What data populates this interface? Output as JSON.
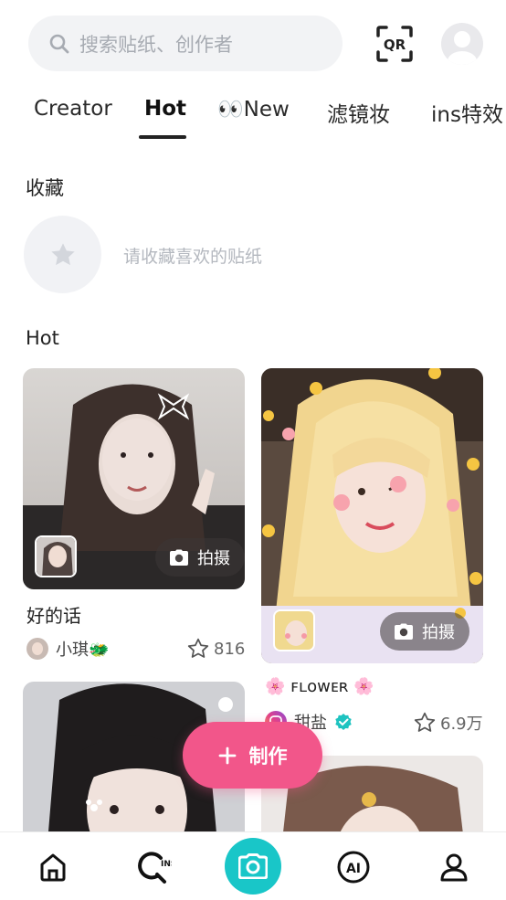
{
  "search": {
    "placeholder": "搜索贴纸、创作者"
  },
  "header": {
    "qr_label": "QR"
  },
  "tabs": [
    {
      "label": "Creator"
    },
    {
      "label": "Hot"
    },
    {
      "label": "👀New"
    },
    {
      "label": "滤镜妆"
    },
    {
      "label": "ins特效"
    }
  ],
  "favorites": {
    "title": "收藏",
    "hint": "请收藏喜欢的贴纸"
  },
  "hot": {
    "title": "Hot"
  },
  "cards": [
    {
      "title": "好的话",
      "shoot_label": "拍摄",
      "author": "小琪🐲",
      "likes": "816"
    },
    {
      "title": "🌸 ꜰʟᴏᴡᴇʀ 🌸",
      "shoot_label": "拍摄",
      "author": "甜盐",
      "likes": "6.9万"
    }
  ],
  "make_button": {
    "label": "制作"
  },
  "colors": {
    "accent_pink": "#f2568a",
    "camera_teal": "#19c6c8",
    "verified_teal": "#1ec3c0"
  },
  "bottom_nav": [
    "home-icon",
    "ins-search-icon",
    "camera-icon",
    "ai-icon",
    "profile-icon"
  ]
}
